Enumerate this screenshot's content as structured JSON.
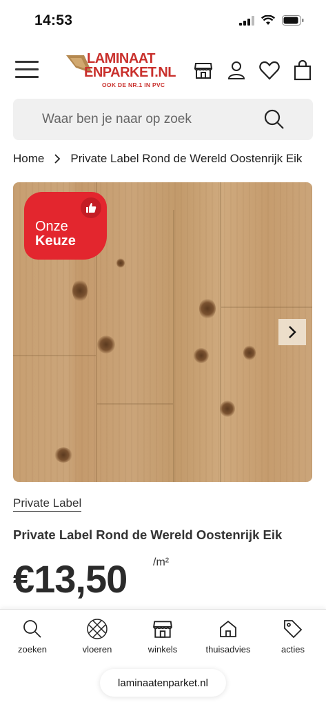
{
  "status_bar": {
    "time": "14:53"
  },
  "header": {
    "logo": {
      "line1": "LAMINAAT",
      "line2": "ENPARKET.NL",
      "tagline": "OOK DE NR.1 IN PVC"
    },
    "icons": [
      "menu-icon",
      "store-icon",
      "account-icon",
      "heart-icon",
      "bag-icon"
    ]
  },
  "search": {
    "placeholder": "Waar ben je naar op zoek"
  },
  "breadcrumb": {
    "home": "Home",
    "current": "Private Label Rond de Wereld Oostenrijk Eik"
  },
  "product": {
    "badge": {
      "line1": "Onze",
      "line2": "Keuze"
    },
    "brand": "Private Label",
    "title": "Private Label Rond de Wereld Oostenrijk Eik",
    "price": "€13,50",
    "unit": "/m²"
  },
  "bottom_nav": {
    "items": [
      {
        "label": "zoeken",
        "icon": "search-icon"
      },
      {
        "label": "vloeren",
        "icon": "floor-pattern-icon"
      },
      {
        "label": "winkels",
        "icon": "store-icon"
      },
      {
        "label": "thuisadvies",
        "icon": "home-icon"
      },
      {
        "label": "acties",
        "icon": "tag-icon"
      }
    ]
  },
  "browser": {
    "url": "laminaatenparket.nl"
  },
  "colors": {
    "brand_red": "#e3262e",
    "logo_red": "#c9302c",
    "search_bg": "#f0f0f0"
  }
}
